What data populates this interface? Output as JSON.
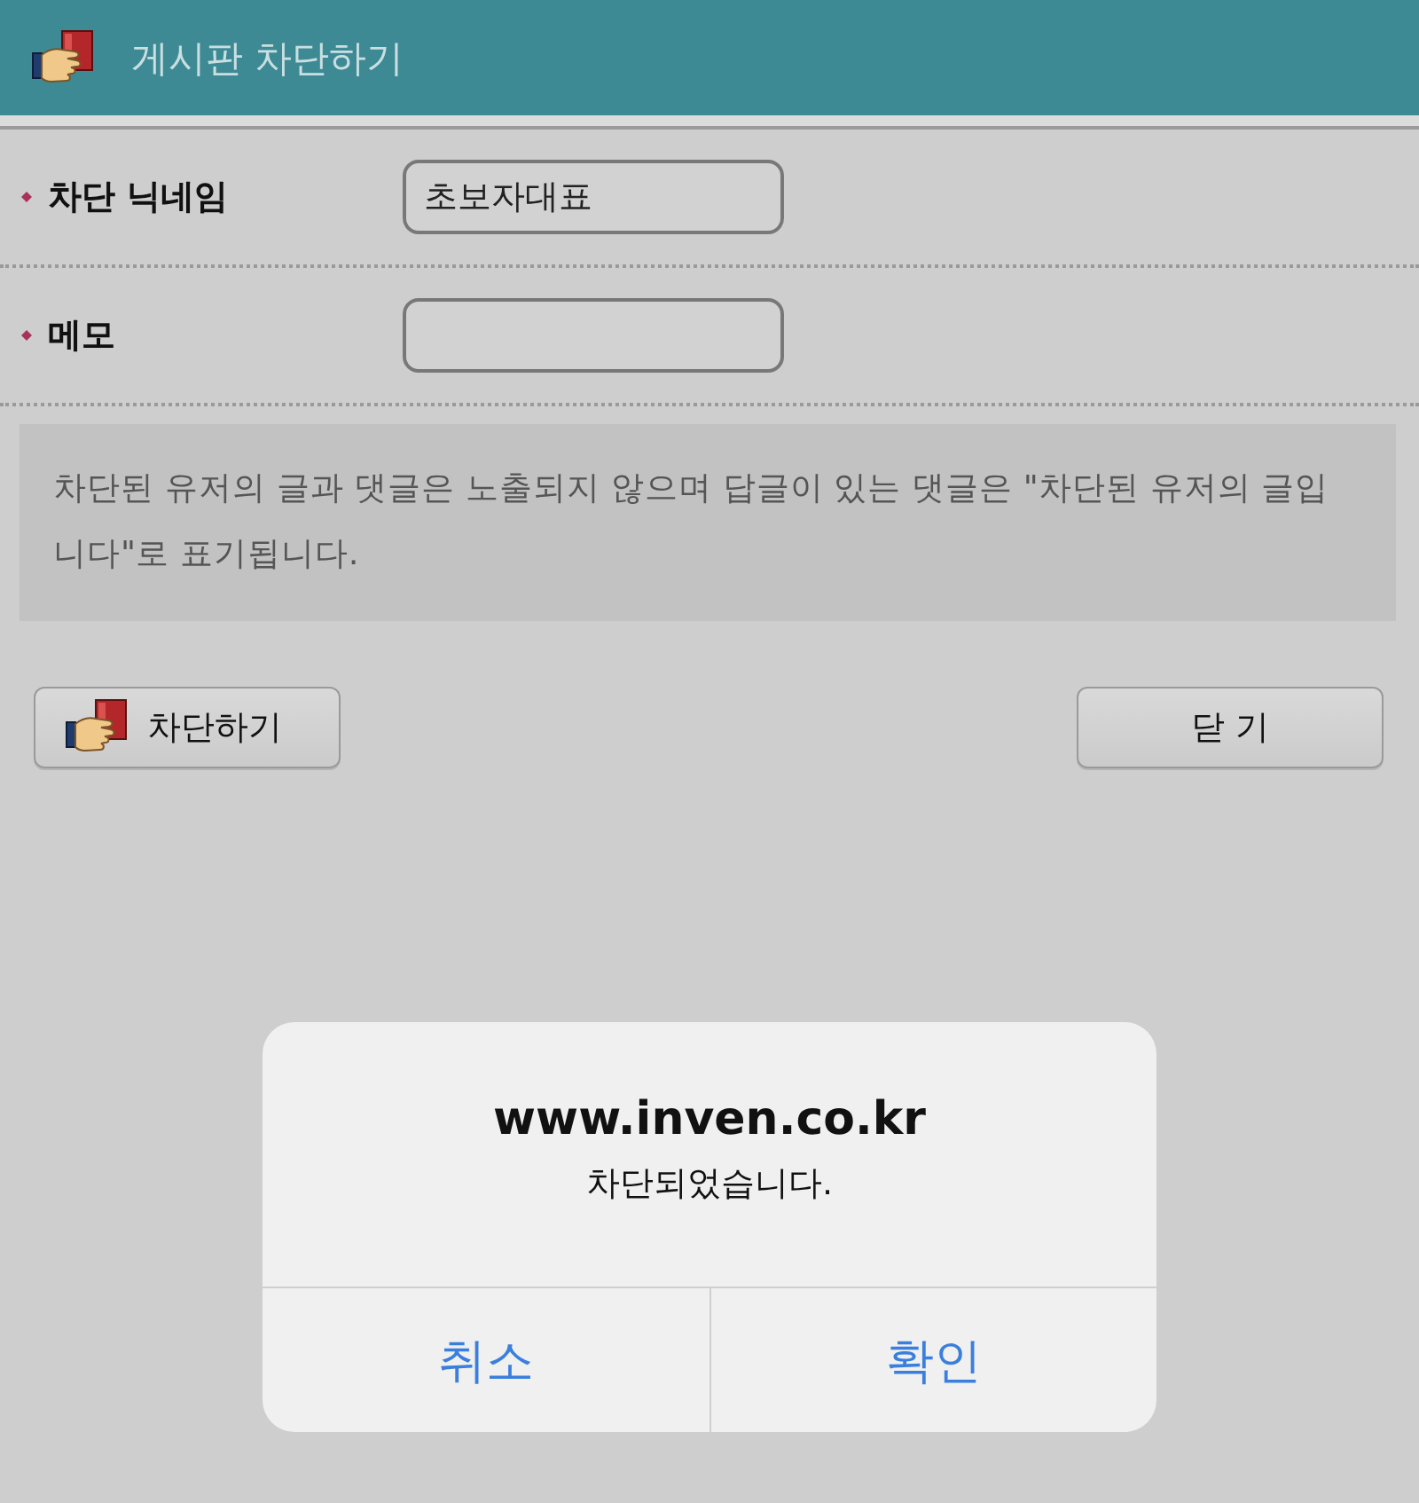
{
  "header": {
    "title": "게시판 차단하기"
  },
  "form": {
    "fields": [
      {
        "label": "차단 닉네임",
        "value": "초보자대표"
      },
      {
        "label": "메모"
      }
    ]
  },
  "notice": "차단된 유저의 글과 댓글은 노출되지 않으며 답글이 있는 댓글은 \"차단된 유저의 글입니다\"로 표기됩니다.",
  "buttons": [
    {
      "kind": "icon",
      "label": "차단하기"
    },
    {
      "kind": "text",
      "label": "닫 기"
    }
  ],
  "alert": {
    "title": "www.inven.co.kr",
    "message": "차단되었습니다.",
    "buttons": [
      {
        "label": "취소"
      },
      {
        "label": "확인"
      }
    ]
  }
}
